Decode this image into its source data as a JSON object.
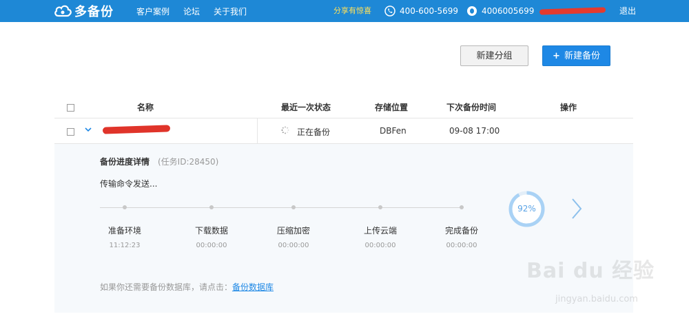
{
  "header": {
    "logo_text": "多备份",
    "nav": [
      "客户案例",
      "论坛",
      "关于我们"
    ],
    "promo": "分享有惊喜",
    "phone": "400-600-5699",
    "qq": "4006005699",
    "logout": "退出"
  },
  "actions": {
    "new_group": "新建分组",
    "new_backup": "新建备份",
    "plus": "+"
  },
  "table": {
    "columns": [
      "名称",
      "最近一次状态",
      "存储位置",
      "下次备份时间",
      "操作"
    ],
    "row": {
      "status": "正在备份",
      "storage": "DBFen",
      "next_time": "09-08 17:00"
    }
  },
  "detail": {
    "title": "备份进度详情",
    "task_id": "(任务ID:28450)",
    "message": "传输命令发送...",
    "steps": [
      {
        "label": "准备环境",
        "time": "11:12:23"
      },
      {
        "label": "下载数据",
        "time": "00:00:00"
      },
      {
        "label": "压缩加密",
        "time": "00:00:00"
      },
      {
        "label": "上传云端",
        "time": "00:00:00"
      },
      {
        "label": "完成备份",
        "time": "00:00:00"
      }
    ],
    "progress_text": "92%",
    "progress_value": 92,
    "footer_text": "如果你还需要备份数据库，请点击：",
    "footer_link": "备份数据库"
  },
  "watermark": {
    "main": "Bai du 经验",
    "sub": "jingyan.baidu.com"
  },
  "colors": {
    "brand": "#1e88d6",
    "accent": "#1e88e5",
    "promo": "#ffe15a",
    "progress_ring": "#a9d2f5"
  }
}
